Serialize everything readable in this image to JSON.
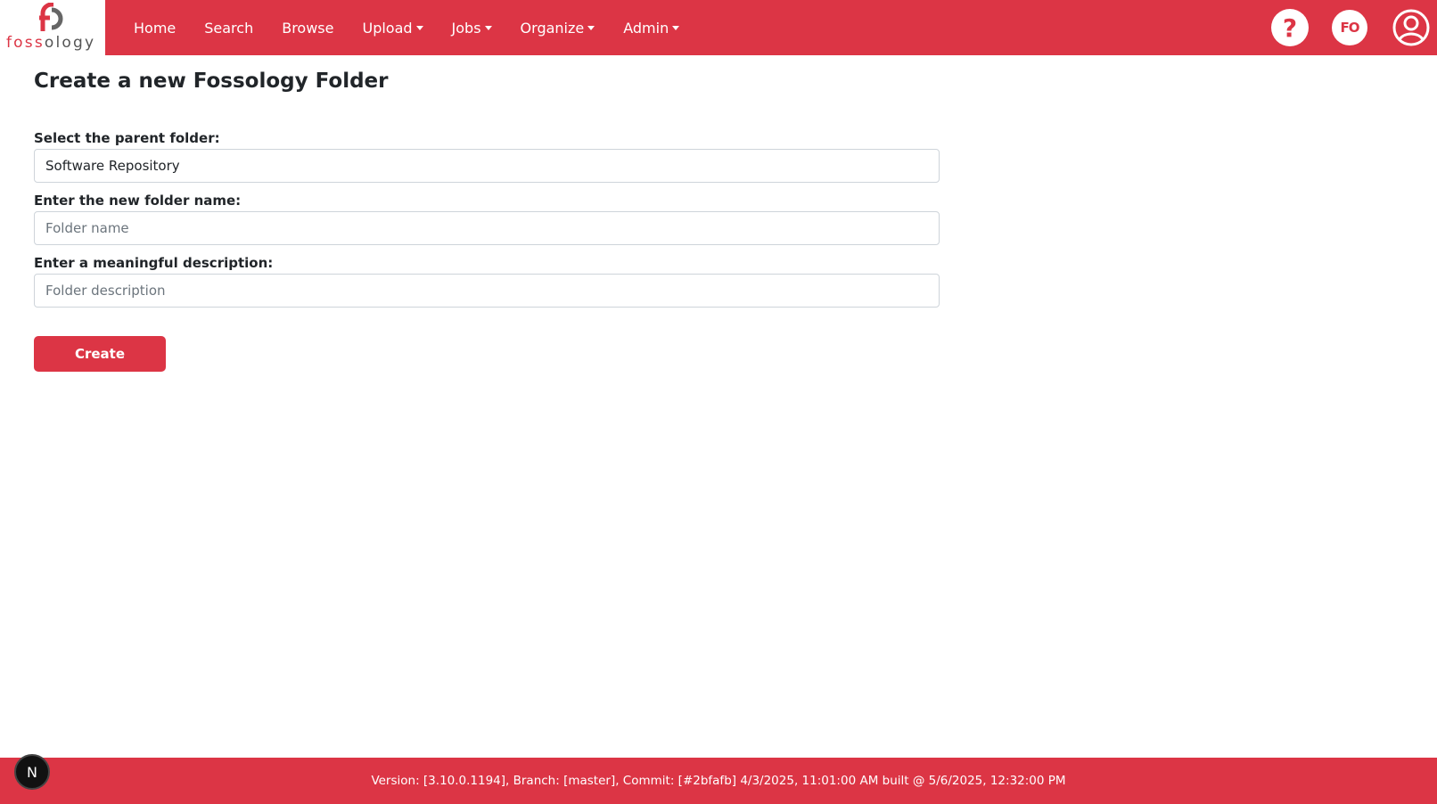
{
  "brand": {
    "logo_text_red": "foss",
    "logo_text_grey": "ology",
    "logo_icon": "fossology-logo-icon"
  },
  "nav": {
    "items": [
      {
        "label": "Home",
        "dropdown": false
      },
      {
        "label": "Search",
        "dropdown": false
      },
      {
        "label": "Browse",
        "dropdown": false
      },
      {
        "label": "Upload",
        "dropdown": true
      },
      {
        "label": "Jobs",
        "dropdown": true
      },
      {
        "label": "Organize",
        "dropdown": true
      },
      {
        "label": "Admin",
        "dropdown": true
      }
    ],
    "help_icon": "?",
    "user_initials": "FO",
    "account_icon": "user-circle-icon"
  },
  "page": {
    "title": "Create a new Fossology Folder"
  },
  "form": {
    "parent_label": "Select the parent folder:",
    "parent_value": "Software Repository",
    "name_label": "Enter the new folder name:",
    "name_placeholder": "Folder name",
    "description_label": "Enter a meaningful description:",
    "description_placeholder": "Folder description",
    "submit_label": "Create"
  },
  "footer": {
    "version_text": "Version: [3.10.0.1194], Branch: [master], Commit: [#2bfafb] 4/3/2025, 11:01:00 AM built @ 5/6/2025, 12:32:00 PM"
  },
  "dev_badge": {
    "label": "N"
  },
  "colors": {
    "brand_red": "#dc3545",
    "white": "#ffffff",
    "text": "#212529"
  }
}
